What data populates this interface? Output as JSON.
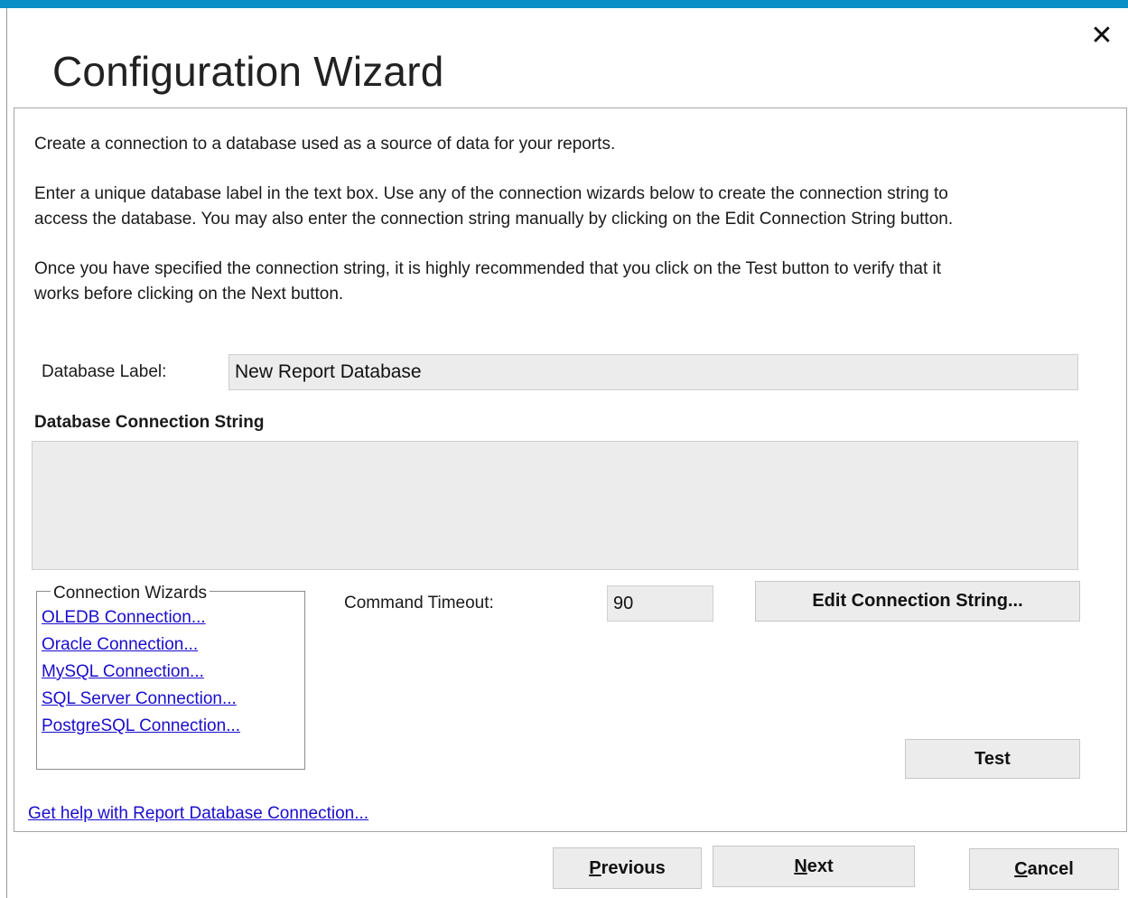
{
  "colors": {
    "accent": "#0a8fc7"
  },
  "dialog": {
    "title": "Configuration Wizard",
    "close_icon": "close-icon"
  },
  "intro": {
    "p1": "Create a connection to a database used as a source of data for your reports.",
    "p2_line1": "Enter a unique database label in the text box. Use any of the connection wizards below to create the connection string to",
    "p2_line2": "access the database. You may also enter the connection string manually by clicking on the Edit Connection String button.",
    "p3_line1": "Once you have specified the connection string, it is highly recommended that you click on the Test button to verify that it",
    "p3_line2": "works before clicking on the Next button."
  },
  "form": {
    "db_label": "Database Label:",
    "db_label_value": "New Report Database",
    "conn_string_heading": "Database Connection String",
    "conn_string_value": "",
    "command_timeout_label": "Command Timeout:",
    "command_timeout_value": "90"
  },
  "wizards": {
    "legend": "Connection Wizards",
    "links": [
      "OLEDB Connection...",
      "Oracle Connection...",
      "MySQL Connection...",
      "SQL Server Connection...",
      "PostgreSQL Connection..."
    ]
  },
  "buttons": {
    "edit_connection": "Edit Connection String...",
    "test": "Test"
  },
  "help_link": "Get help with Report Database Connection...",
  "footer": {
    "previous_accel": "P",
    "previous_rest": "revious",
    "next_accel": "N",
    "next_rest": "ext",
    "cancel_accel": "C",
    "cancel_rest": "ancel"
  }
}
